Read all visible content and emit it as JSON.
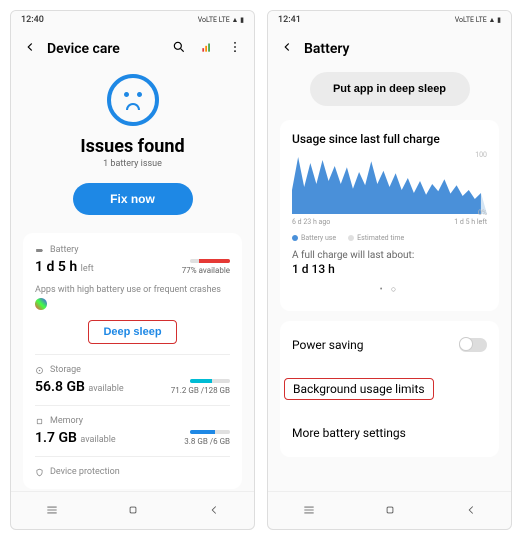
{
  "screen1": {
    "statusbar": {
      "time": "12:40",
      "indicators": "VoLTE LTE ▲ ▮"
    },
    "header": {
      "title": "Device care"
    },
    "issue": {
      "title": "Issues found",
      "sub": "1 battery issue",
      "fix_btn": "Fix now"
    },
    "battery": {
      "label": "Battery",
      "value": "1 d 5 h",
      "unit": "left",
      "pct_label": "77% available",
      "note": "Apps with high battery use or frequent crashes",
      "deep_sleep_btn": "Deep sleep"
    },
    "storage": {
      "label": "Storage",
      "value": "56.8 GB",
      "unit": "available",
      "bar_label": "71.2 GB /128 GB"
    },
    "memory": {
      "label": "Memory",
      "value": "1.7 GB",
      "unit": "available",
      "bar_label": "3.8 GB /6 GB"
    },
    "protection": {
      "label": "Device protection"
    }
  },
  "screen2": {
    "statusbar": {
      "time": "12:41",
      "indicators": "VoLTE LTE ▲ ▮"
    },
    "header": {
      "title": "Battery"
    },
    "deep_sleep_btn": "Put app in deep sleep",
    "usage": {
      "title": "Usage since last full charge",
      "left_label": "6 d 23 h ago",
      "right_label": "1 d 5 h left",
      "legend_battery": "Battery use",
      "legend_est": "Estimated time",
      "full_text": "A full charge will last about:",
      "full_val": "1 d 13 h"
    },
    "settings": {
      "power_saving": "Power saving",
      "bg_limits": "Background usage limits",
      "more": "More battery settings"
    }
  },
  "chart_data": {
    "type": "area",
    "title": "Usage since last full charge",
    "xlabel": "",
    "ylabel": "",
    "ylim": [
      0,
      100
    ],
    "x": [
      0,
      1,
      2,
      3,
      4,
      5,
      6,
      7,
      8,
      9,
      10,
      11,
      12,
      13,
      14,
      15,
      16,
      17,
      18,
      19,
      20,
      21,
      22,
      23,
      24,
      25,
      26,
      27,
      28,
      29,
      30,
      31,
      32
    ],
    "series": [
      {
        "name": "Battery use",
        "color": "#4a90d9",
        "values": [
          40,
          95,
          45,
          85,
          50,
          90,
          55,
          80,
          50,
          78,
          42,
          70,
          48,
          88,
          50,
          72,
          45,
          68,
          40,
          60,
          35,
          55,
          32,
          50,
          38,
          58,
          34,
          48,
          30,
          40,
          25,
          35,
          20
        ]
      },
      {
        "name": "Estimated time",
        "color": "#b8d4ec",
        "style": "hatched",
        "values": [
          null,
          null,
          null,
          null,
          null,
          null,
          null,
          null,
          null,
          null,
          null,
          null,
          null,
          null,
          null,
          null,
          null,
          null,
          null,
          null,
          null,
          null,
          null,
          null,
          null,
          null,
          null,
          null,
          null,
          null,
          null,
          35,
          0
        ]
      }
    ],
    "legend": [
      "Battery use",
      "Estimated time"
    ]
  }
}
